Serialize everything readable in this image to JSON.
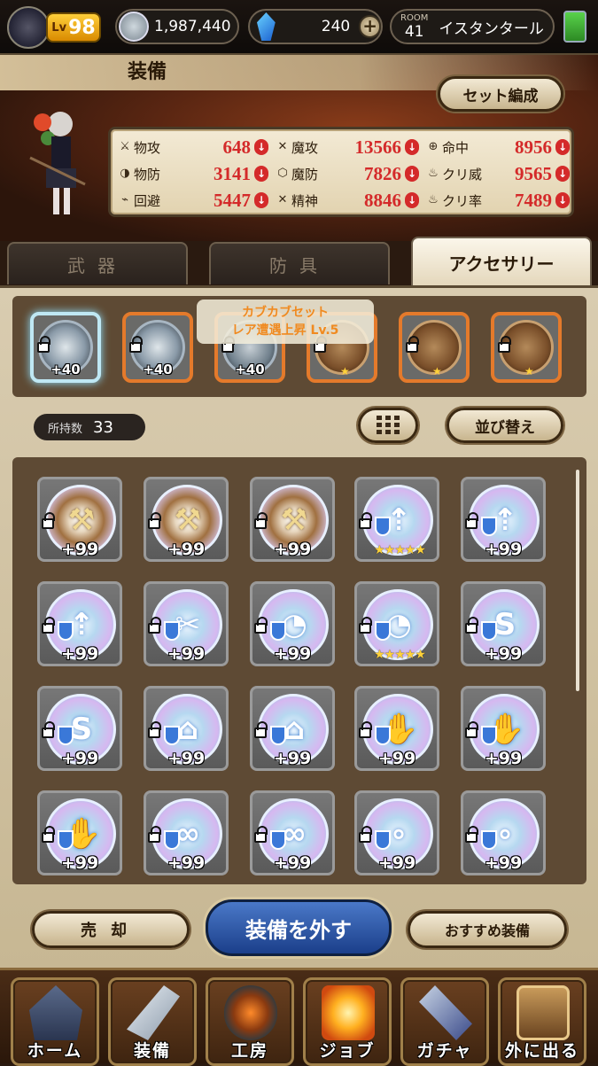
{
  "header": {
    "level_label": "Lv",
    "level": "98",
    "coins": "1,987,440",
    "gems": "240",
    "room_label": "ROOM",
    "room_number": "41",
    "room_name": "イスタンタール"
  },
  "page": {
    "title": "装備",
    "set_button": "セット編成"
  },
  "stats": [
    {
      "label": "物攻",
      "value": "648"
    },
    {
      "label": "魔攻",
      "value": "13566"
    },
    {
      "label": "命中",
      "value": "8956"
    },
    {
      "label": "物防",
      "value": "3141"
    },
    {
      "label": "魔防",
      "value": "7826"
    },
    {
      "label": "クリ威",
      "value": "9565"
    },
    {
      "label": "回避",
      "value": "5447"
    },
    {
      "label": "精神",
      "value": "8846"
    },
    {
      "label": "クリ率",
      "value": "7489"
    }
  ],
  "tabs": {
    "weapon": "武器",
    "armor": "防具",
    "accessory": "アクセサリー"
  },
  "equipped": [
    {
      "level": "+40"
    },
    {
      "level": "+40"
    },
    {
      "level": "+40"
    },
    {
      "level": ""
    },
    {
      "level": ""
    },
    {
      "level": ""
    }
  ],
  "tooltip": {
    "line1": "カブカブセット",
    "line2": "レア遭遇上昇 Lv.5"
  },
  "inventory": {
    "count_label": "所持数",
    "count": "33",
    "sort_button": "並び替え",
    "items": [
      {
        "level": "+99"
      },
      {
        "level": "+99"
      },
      {
        "level": "+99"
      },
      {
        "level": "★★★★★"
      },
      {
        "level": "+99"
      },
      {
        "level": "+99"
      },
      {
        "level": "+99"
      },
      {
        "level": "+99"
      },
      {
        "level": "★★★★★"
      },
      {
        "level": "+99"
      },
      {
        "level": "+99"
      },
      {
        "level": "+99"
      },
      {
        "level": "+99"
      },
      {
        "level": "+99"
      },
      {
        "level": "+99"
      },
      {
        "level": "+99"
      },
      {
        "level": "+99"
      },
      {
        "level": "+99"
      },
      {
        "level": "+99"
      },
      {
        "level": "+99"
      }
    ]
  },
  "actions": {
    "sell": "売却",
    "remove": "装備を外す",
    "recommend": "おすすめ装備"
  },
  "nav": {
    "home": "ホーム",
    "equip": "装備",
    "workshop": "工房",
    "job": "ジョブ",
    "gacha": "ガチャ",
    "exit": "外に出る"
  },
  "colors": {
    "stat_value": "#d42a2a",
    "slot_border": "#e47a2b",
    "remove_button": "#2a55a8"
  }
}
